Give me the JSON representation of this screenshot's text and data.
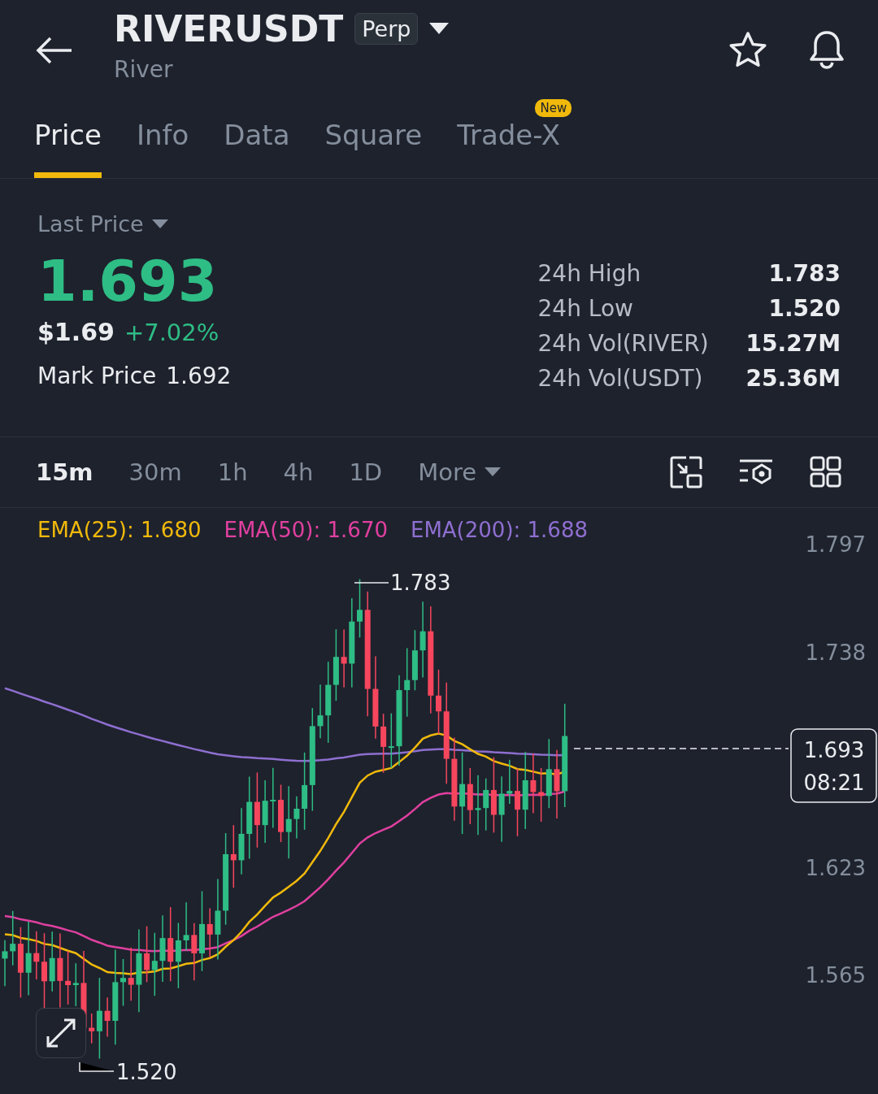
{
  "header": {
    "symbol": "RIVERUSDT",
    "badge": "Perp",
    "name": "River"
  },
  "tabs": [
    {
      "label": "Price",
      "selected": true
    },
    {
      "label": "Info",
      "selected": false
    },
    {
      "label": "Data",
      "selected": false
    },
    {
      "label": "Square",
      "selected": false
    },
    {
      "label": "Trade-X",
      "selected": false,
      "badge": "New"
    }
  ],
  "price": {
    "label": "Last Price",
    "value": "1.693",
    "usd": "$1.69",
    "change": "+7.02%",
    "mark_label": "Mark Price",
    "mark_value": "1.692"
  },
  "stats": [
    {
      "label": "24h High",
      "value": "1.783"
    },
    {
      "label": "24h Low",
      "value": "1.520"
    },
    {
      "label": "24h Vol(RIVER)",
      "value": "15.27M"
    },
    {
      "label": "24h Vol(USDT)",
      "value": "25.36M"
    }
  ],
  "intervals": [
    {
      "label": "15m",
      "selected": true
    },
    {
      "label": "30m",
      "selected": false
    },
    {
      "label": "1h",
      "selected": false
    },
    {
      "label": "4h",
      "selected": false
    },
    {
      "label": "1D",
      "selected": false
    }
  ],
  "more": "More",
  "legend": [
    {
      "label": "EMA(25): 1.680",
      "color": "#f0b90b"
    },
    {
      "label": "EMA(50): 1.670",
      "color": "#e040a0"
    },
    {
      "label": "EMA(200): 1.688",
      "color": "#8e6fd0"
    }
  ],
  "chart": {
    "y_labels": [
      "1.797",
      "1.738",
      "1.623",
      "1.565"
    ],
    "high": "1.783",
    "low": "1.520",
    "current": "1.693",
    "countdown": "08:21"
  }
}
